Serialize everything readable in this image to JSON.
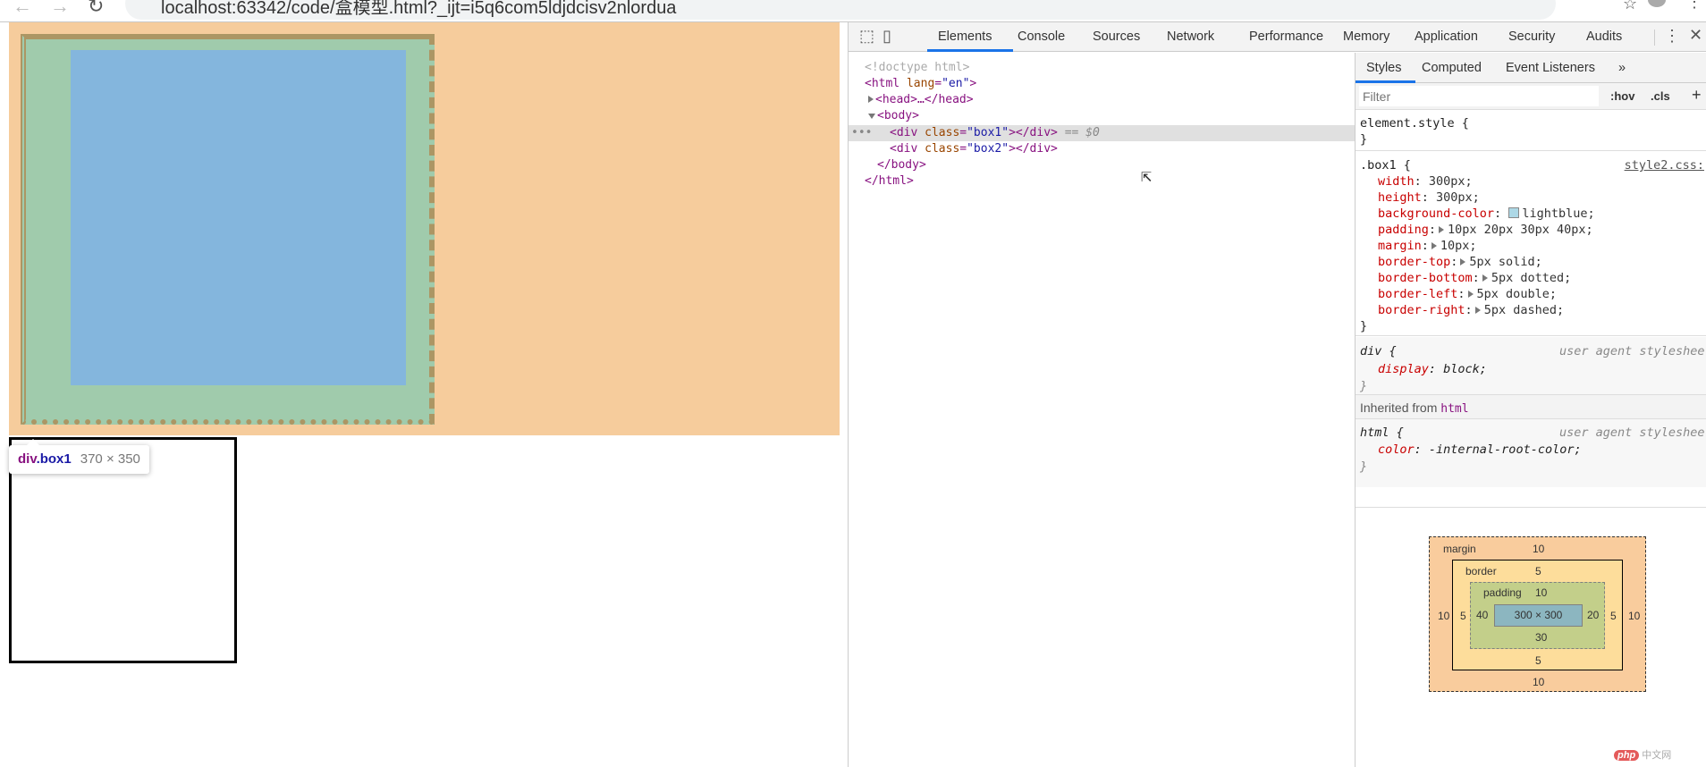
{
  "browser": {
    "url": "localhost:63342/code/盒模型.html?_ijt=i5q6com5ldjdcisv2nlordua"
  },
  "page": {
    "tooltip": {
      "tag": "div",
      "class": ".box1",
      "size": "370 × 350"
    }
  },
  "devtools": {
    "tabs": [
      "Elements",
      "Console",
      "Sources",
      "Network",
      "Performance",
      "Memory",
      "Application",
      "Security",
      "Audits"
    ],
    "active_tab": "Elements",
    "dom": {
      "doctype": "<!doctype html>",
      "html_open": "<html",
      "lang_attr": "lang",
      "lang_val": "\"en\"",
      "head": "<head>…</head>",
      "body_open": "<body>",
      "box1_div": "<div class=\"box1\"></div>",
      "box1_class": "\"box1\"",
      "box2_class": "\"box2\"",
      "selected_marker": "== $0",
      "body_close": "</body>",
      "html_close": "</html>"
    },
    "styles": {
      "subtabs": [
        "Styles",
        "Computed",
        "Event Listeners"
      ],
      "more": "»",
      "filter_placeholder": "Filter",
      "hov": ":hov",
      "cls": ".cls",
      "add": "+",
      "element_style": "element.style {",
      "box1_selector": ".box1 {",
      "box1_source": "style2.css:",
      "box1_props": [
        {
          "name": "width",
          "value": "300px;"
        },
        {
          "name": "height",
          "value": "300px;"
        },
        {
          "name": "background-color",
          "value": "lightblue;",
          "swatch": "#add8e6"
        },
        {
          "name": "padding",
          "value": "10px 20px 30px 40px;"
        },
        {
          "name": "margin",
          "value": "10px;"
        },
        {
          "name": "border-top",
          "value": "5px solid;"
        },
        {
          "name": "border-bottom",
          "value": "5px dotted;"
        },
        {
          "name": "border-left",
          "value": "5px double;"
        },
        {
          "name": "border-right",
          "value": "5px dashed;"
        }
      ],
      "div_selector": "div {",
      "ua_label": "user agent styleshee",
      "div_prop": {
        "name": "display",
        "value": "block;"
      },
      "inherited_label": "Inherited from",
      "inherited_tag": "html",
      "html_selector": "html {",
      "html_prop": {
        "name": "color",
        "value": "-internal-root-color;"
      },
      "close": "}"
    },
    "box_model": {
      "margin_label": "margin",
      "border_label": "border",
      "padding_label": "padding",
      "margin": {
        "top": "10",
        "right": "10",
        "bottom": "10",
        "left": "10"
      },
      "border": {
        "top": "5",
        "right": "5",
        "bottom": "5",
        "left": "5"
      },
      "padding": {
        "top": "10",
        "right": "20",
        "bottom": "30",
        "left": "40"
      },
      "content": "300 × 300"
    }
  },
  "watermark": {
    "logo": "php",
    "text": "中文网"
  },
  "colors": {
    "margin": "#f6cc9c",
    "border": "#ac9664",
    "padding": "#a0cbac",
    "content": "#84b6dd",
    "accent": "#1a73e8"
  }
}
